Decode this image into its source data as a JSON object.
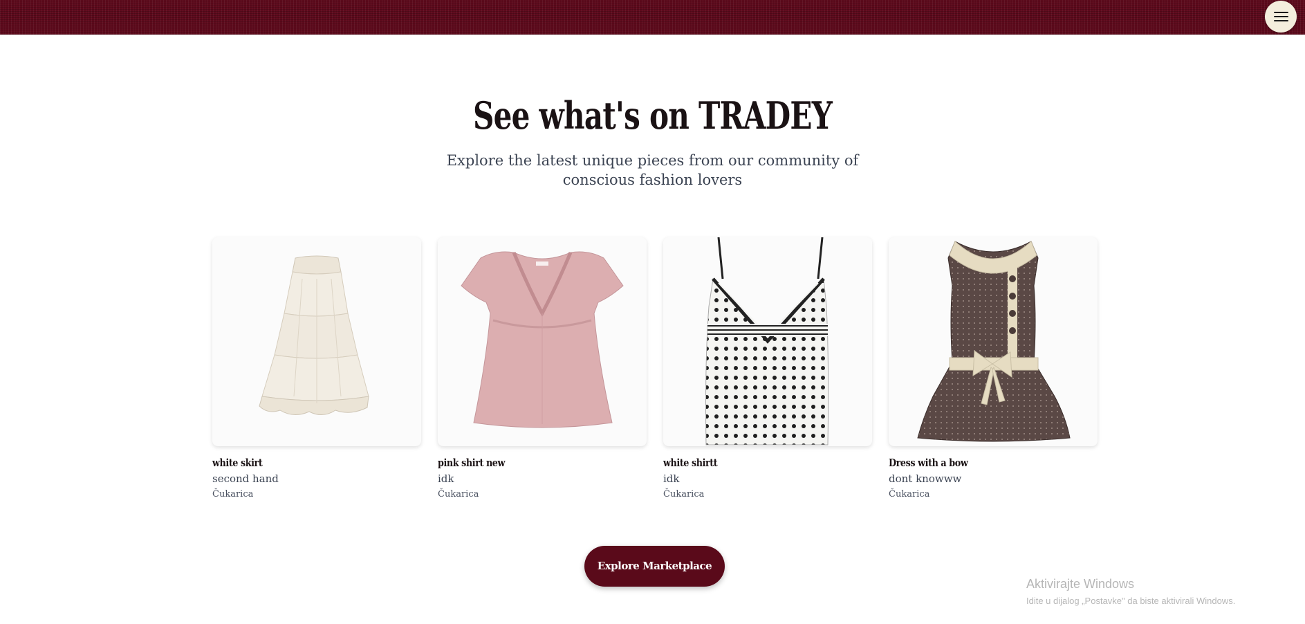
{
  "header": {
    "menu_icon": "hamburger-menu-icon",
    "background_color": "#5e0a1c"
  },
  "section": {
    "title": "See what's on TRADEY",
    "subtitle": "Explore the latest unique pieces from our community of conscious fashion lovers"
  },
  "products": [
    {
      "title": "white skirt",
      "description": "second hand",
      "location": "Čukarica",
      "image": "white-tiered-skirt"
    },
    {
      "title": "pink shirt new",
      "description": "idk",
      "location": "Čukarica",
      "image": "pink-lace-blouse"
    },
    {
      "title": "white shirtt",
      "description": "idk",
      "location": "Čukarica",
      "image": "polka-dot-camisole"
    },
    {
      "title": "Dress with a bow",
      "description": "dont knowww",
      "location": "Čukarica",
      "image": "brown-dress-with-bow"
    }
  ],
  "cta": {
    "label": "Explore Marketplace",
    "color": "#5a0a1a"
  },
  "watermark": {
    "title": "Aktivirajte Windows",
    "subtitle": "Idite u dijalog „Postavke\" da biste aktivirali Windows."
  }
}
